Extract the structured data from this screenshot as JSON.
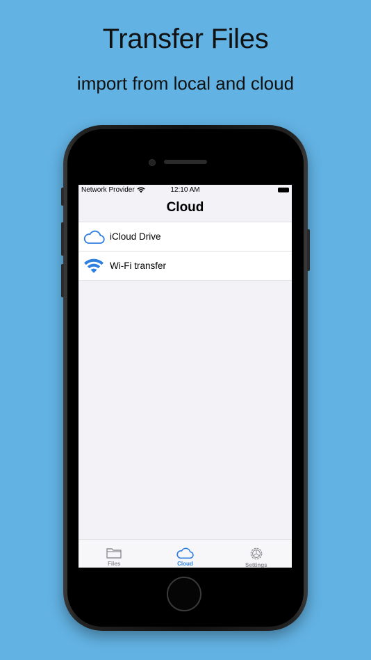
{
  "promo": {
    "title": "Transfer Files",
    "subtitle": "import from local and cloud"
  },
  "status_bar": {
    "carrier": "Network Provider",
    "time": "12:10 AM"
  },
  "nav": {
    "title": "Cloud"
  },
  "list": {
    "items": [
      {
        "label": "iCloud Drive",
        "icon": "cloud-icon"
      },
      {
        "label": "Wi-Fi transfer",
        "icon": "wifi-icon"
      }
    ]
  },
  "tab_bar": {
    "tabs": [
      {
        "label": "Files",
        "icon": "folder-icon",
        "active": false
      },
      {
        "label": "Cloud",
        "icon": "cloud-icon",
        "active": true
      },
      {
        "label": "Settings",
        "icon": "gear-icon",
        "active": false
      }
    ]
  },
  "colors": {
    "background": "#62b2e3",
    "accent": "#2f7fe0",
    "inactive_tab": "#8e8e93"
  }
}
